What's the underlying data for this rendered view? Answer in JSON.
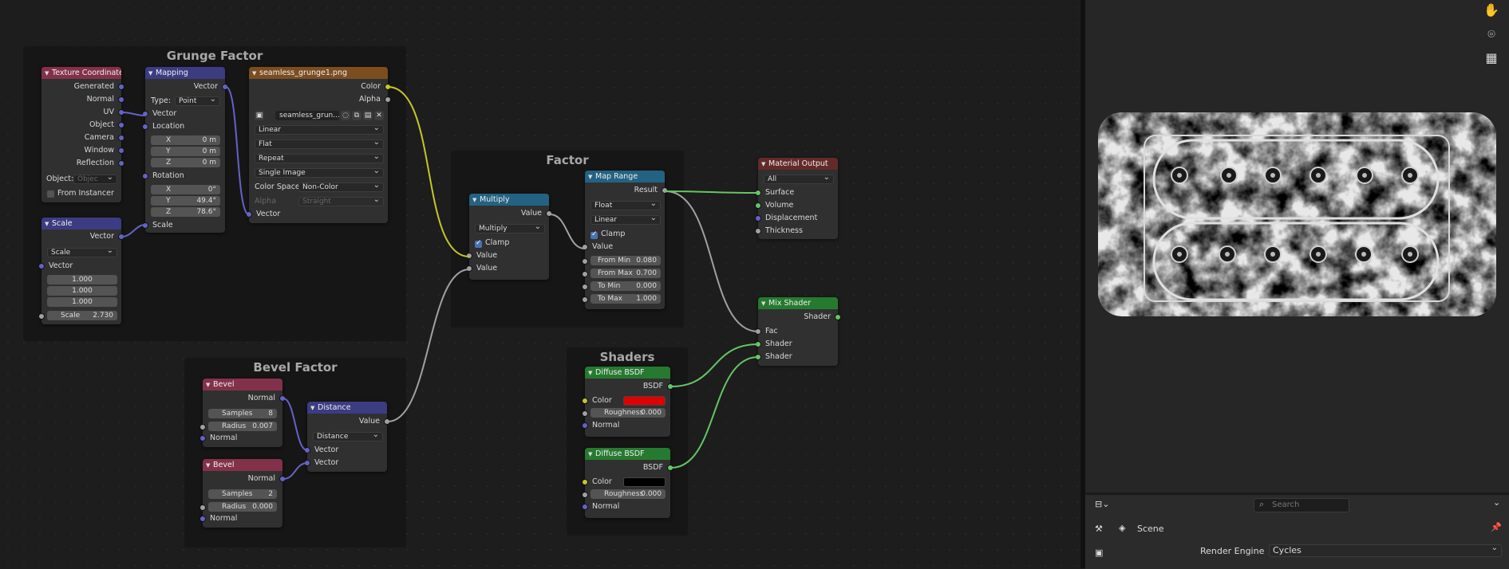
{
  "frames": {
    "grunge": "Grunge Factor",
    "bevel": "Bevel Factor",
    "factor": "Factor",
    "shaders": "Shaders"
  },
  "nodes": {
    "texcoord": {
      "title": "Texture Coordinate",
      "outputs": [
        "Generated",
        "Normal",
        "UV",
        "Object",
        "Camera",
        "Window",
        "Reflection"
      ],
      "object_label": "Object:",
      "object_placeholder": "Objec",
      "from_instancer": "From Instancer"
    },
    "mapping": {
      "title": "Mapping",
      "out": "Vector",
      "type_label": "Type:",
      "type_value": "Point",
      "vector": "Vector",
      "location": "Location",
      "loc": [
        {
          "k": "X",
          "v": "0 m"
        },
        {
          "k": "Y",
          "v": "0 m"
        },
        {
          "k": "Z",
          "v": "0 m"
        }
      ],
      "rotation": "Rotation",
      "rot": [
        {
          "k": "X",
          "v": "0°"
        },
        {
          "k": "Y",
          "v": "49.4°"
        },
        {
          "k": "Z",
          "v": "78.6°"
        }
      ],
      "scale": "Scale"
    },
    "image": {
      "title": "seamless_grunge1.png",
      "color": "Color",
      "alpha": "Alpha",
      "img_name": "seamless_grun...",
      "interp": "Linear",
      "proj": "Flat",
      "ext": "Repeat",
      "source": "Single Image",
      "cs_label": "Color Space",
      "cs_value": "Non-Color",
      "alpha_label": "Alpha",
      "alpha_value": "Straight",
      "vector": "Vector"
    },
    "scale": {
      "title": "Scale",
      "out": "Vector",
      "mode": "Scale",
      "vector": "Vector",
      "vals": [
        "1.000",
        "1.000",
        "1.000"
      ],
      "scale_label": "Scale",
      "scale_value": "2.730"
    },
    "multiply": {
      "title": "Multiply",
      "out": "Value",
      "op": "Multiply",
      "clamp": "Clamp",
      "in1": "Value",
      "in2": "Value"
    },
    "maprange": {
      "title": "Map Range",
      "out": "Result",
      "dtype": "Float",
      "interp": "Linear",
      "clamp": "Clamp",
      "value": "Value",
      "fields": [
        {
          "k": "From Min",
          "v": "0.080"
        },
        {
          "k": "From Max",
          "v": "0.700"
        },
        {
          "k": "To Min",
          "v": "0.000"
        },
        {
          "k": "To Max",
          "v": "1.000"
        }
      ]
    },
    "matout": {
      "title": "Material Output",
      "target": "All",
      "inputs": [
        "Surface",
        "Volume",
        "Displacement",
        "Thickness"
      ]
    },
    "mix": {
      "title": "Mix Shader",
      "out": "Shader",
      "inputs": [
        "Fac",
        "Shader",
        "Shader"
      ]
    },
    "bevel1": {
      "title": "Bevel",
      "out": "Normal",
      "samples_label": "Samples",
      "samples": "8",
      "radius_label": "Radius",
      "radius": "0.007",
      "normal": "Normal"
    },
    "bevel2": {
      "title": "Bevel",
      "out": "Normal",
      "samples_label": "Samples",
      "samples": "2",
      "radius_label": "Radius",
      "radius": "0.000",
      "normal": "Normal"
    },
    "distance": {
      "title": "Distance",
      "out": "Value",
      "op": "Distance",
      "in1": "Vector",
      "in2": "Vector"
    },
    "diffuse1": {
      "title": "Diffuse BSDF",
      "out": "BSDF",
      "color_label": "Color",
      "color": "#e00000",
      "rough_label": "Roughness",
      "rough": "0.000",
      "normal": "Normal"
    },
    "diffuse2": {
      "title": "Diffuse BSDF",
      "out": "BSDF",
      "color_label": "Color",
      "color": "#000000",
      "rough_label": "Roughness",
      "rough": "0.000",
      "normal": "Normal"
    }
  },
  "viewport": {
    "icons": [
      "hand-icon",
      "camera-icon",
      "grid-icon"
    ]
  },
  "properties": {
    "search_placeholder": "Search",
    "scene": "Scene",
    "render_engine_label": "Render Engine",
    "render_engine": "Cycles"
  }
}
